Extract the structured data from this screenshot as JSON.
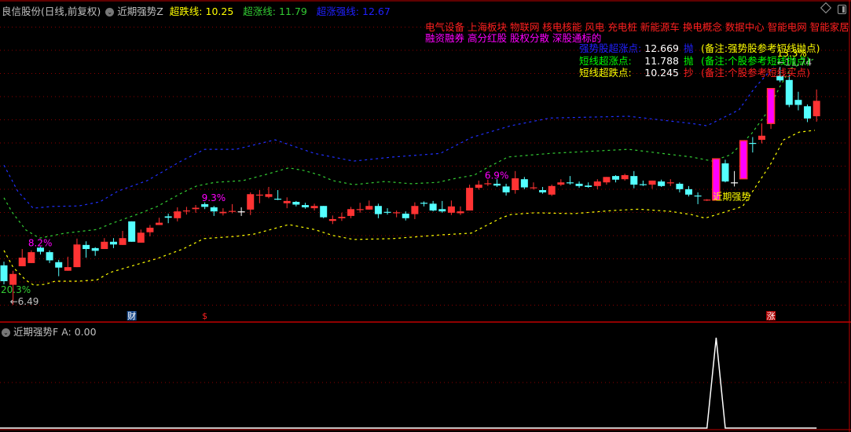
{
  "header": {
    "stock": "良信股份(日线,前复权)",
    "indicator": "近期强势Z",
    "lines": [
      {
        "label": "超跌线:",
        "value": "10.25",
        "color": "#ffff00"
      },
      {
        "label": "超涨线:",
        "value": "11.79",
        "color": "#33cc33"
      },
      {
        "label": "超涨强线:",
        "value": "12.67",
        "color": "#2020ff"
      }
    ]
  },
  "concepts": {
    "line1": "电气设备 上海板块 物联网 核电核能 风电 充电桩 新能源车 换电概念 数据中心 智能电网 智能家居 储能",
    "line2": "融资融券 高分红股 股权分散 深股通标的"
  },
  "info": [
    {
      "label": "强势股超涨点:",
      "value": "12.669",
      "action": "抛",
      "note": "(备注:强势股参考短线抛点)",
      "label_color": "#2020ff",
      "action_color": "#2020ff",
      "note_color": "#ffff00"
    },
    {
      "label": "短线超涨点:",
      "value": "11.788",
      "action": "抛",
      "note": "(备注:个股参考短线抛点)",
      "label_color": "#00ff00",
      "action_color": "#00ff00",
      "note_color": "#00ff00"
    },
    {
      "label": "短线超跌点:",
      "value": "10.245",
      "action": "抄",
      "note": "(备注:个股参考短线买点)",
      "label_color": "#ffff00",
      "action_color": "#ff2020",
      "note_color": "#ff2020"
    }
  ],
  "lower": {
    "title": "近期强势F",
    "value": "A: 0.00"
  },
  "colors": {
    "up": "#ff3333",
    "down": "#54ffff",
    "strong": "#ff00ff",
    "doji": "#ffffff",
    "grid": "#8b0000",
    "frame": "#c00000"
  },
  "chart_data": {
    "type": "candlestick",
    "title": "良信股份(日线,前复权)",
    "ylim": [
      6.49,
      11.74
    ],
    "candles_ohlc": [
      [
        7.36,
        7.44,
        6.94,
        7.01
      ],
      [
        6.93,
        7.24,
        6.49,
        7.17
      ],
      [
        7.34,
        7.72,
        7.34,
        7.53
      ],
      [
        7.41,
        7.69,
        7.41,
        7.65
      ],
      [
        7.75,
        7.77,
        7.6,
        7.66
      ],
      [
        7.65,
        7.69,
        7.41,
        7.47
      ],
      [
        7.43,
        7.48,
        7.12,
        7.31
      ],
      [
        7.24,
        7.55,
        7.24,
        7.32
      ],
      [
        7.32,
        7.95,
        7.32,
        7.82
      ],
      [
        7.81,
        7.89,
        7.53,
        7.72
      ],
      [
        7.74,
        7.76,
        7.57,
        7.68
      ],
      [
        7.72,
        7.96,
        7.72,
        7.88
      ],
      [
        7.88,
        7.96,
        7.74,
        7.82
      ],
      [
        7.81,
        8.12,
        7.81,
        7.96
      ],
      [
        8.33,
        8.33,
        7.88,
        7.88
      ],
      [
        7.86,
        8.15,
        7.86,
        8.08
      ],
      [
        8.09,
        8.25,
        8.0,
        8.19
      ],
      [
        8.25,
        8.41,
        8.25,
        8.3
      ],
      [
        8.44,
        8.5,
        8.29,
        8.41
      ],
      [
        8.4,
        8.64,
        8.33,
        8.55
      ],
      [
        8.55,
        8.65,
        8.48,
        8.57
      ],
      [
        8.6,
        8.69,
        8.52,
        8.63
      ],
      [
        8.71,
        8.75,
        8.6,
        8.65
      ],
      [
        8.64,
        8.67,
        8.45,
        8.55
      ],
      [
        8.51,
        8.62,
        8.46,
        8.54
      ],
      [
        8.55,
        8.71,
        8.51,
        8.56
      ],
      [
        8.55,
        8.64,
        8.45,
        8.55
      ],
      [
        8.59,
        8.97,
        8.47,
        8.93
      ],
      [
        8.91,
        9.02,
        8.73,
        8.92
      ],
      [
        8.87,
        9.09,
        8.84,
        8.93
      ],
      [
        8.83,
        9.02,
        8.8,
        8.82
      ],
      [
        8.73,
        8.86,
        8.62,
        8.78
      ],
      [
        8.76,
        8.78,
        8.66,
        8.7
      ],
      [
        8.69,
        8.74,
        8.61,
        8.64
      ],
      [
        8.62,
        8.72,
        8.57,
        8.67
      ],
      [
        8.67,
        8.67,
        8.4,
        8.42
      ],
      [
        8.34,
        8.46,
        8.27,
        8.38
      ],
      [
        8.4,
        8.52,
        8.34,
        8.43
      ],
      [
        8.45,
        8.65,
        8.4,
        8.6
      ],
      [
        8.59,
        8.74,
        8.52,
        8.6
      ],
      [
        8.59,
        8.79,
        8.59,
        8.67
      ],
      [
        8.67,
        8.72,
        8.4,
        8.49
      ],
      [
        8.54,
        8.62,
        8.48,
        8.53
      ],
      [
        8.52,
        8.57,
        8.42,
        8.53
      ],
      [
        8.5,
        8.55,
        8.35,
        8.4
      ],
      [
        8.49,
        8.75,
        8.38,
        8.67
      ],
      [
        8.74,
        8.77,
        8.66,
        8.73
      ],
      [
        8.72,
        8.78,
        8.55,
        8.57
      ],
      [
        8.6,
        8.78,
        8.52,
        8.55
      ],
      [
        8.52,
        8.79,
        8.47,
        8.66
      ],
      [
        8.51,
        8.66,
        8.47,
        8.55
      ],
      [
        8.57,
        9.14,
        8.57,
        9.07
      ],
      [
        9.07,
        9.23,
        9.03,
        9.14
      ],
      [
        9.16,
        9.25,
        9.11,
        9.17
      ],
      [
        9.16,
        9.26,
        9.09,
        9.12
      ],
      [
        9.1,
        9.16,
        8.9,
        8.97
      ],
      [
        9.02,
        9.44,
        8.94,
        9.28
      ],
      [
        9.26,
        9.31,
        9.04,
        9.08
      ],
      [
        9.07,
        9.19,
        9.03,
        9.08
      ],
      [
        9.02,
        9.09,
        8.94,
        8.97
      ],
      [
        8.92,
        9.14,
        8.89,
        9.11
      ],
      [
        9.14,
        9.26,
        9.11,
        9.19
      ],
      [
        9.19,
        9.33,
        9.14,
        9.18
      ],
      [
        9.16,
        9.21,
        9.07,
        9.11
      ],
      [
        9.12,
        9.19,
        9.07,
        9.09
      ],
      [
        9.11,
        9.26,
        9.04,
        9.21
      ],
      [
        9.19,
        9.31,
        9.14,
        9.31
      ],
      [
        9.33,
        9.35,
        9.19,
        9.25
      ],
      [
        9.26,
        9.38,
        9.23,
        9.35
      ],
      [
        9.33,
        9.44,
        9.06,
        9.14
      ],
      [
        9.15,
        9.23,
        9.11,
        9.14
      ],
      [
        9.14,
        9.23,
        9.05,
        9.23
      ],
      [
        9.21,
        9.25,
        9.09,
        9.11
      ],
      [
        9.18,
        9.26,
        9.11,
        9.19
      ],
      [
        9.16,
        9.19,
        8.97,
        9.04
      ],
      [
        9.04,
        9.11,
        8.88,
        8.92
      ],
      [
        8.9,
        8.97,
        8.71,
        8.89
      ],
      [
        8.8,
        8.82,
        8.78,
        8.81
      ],
      [
        8.8,
        9.71,
        8.8,
        9.71
      ],
      [
        9.61,
        9.69,
        9.19,
        9.21
      ],
      [
        9.19,
        9.44,
        9.1,
        9.19
      ],
      [
        9.27,
        10.11,
        9.27,
        10.11
      ],
      [
        10.06,
        10.19,
        9.85,
        10.05
      ],
      [
        10.13,
        10.49,
        10.05,
        10.22
      ],
      [
        10.49,
        11.26,
        10.37,
        11.26
      ],
      [
        11.54,
        11.74,
        11.4,
        11.44
      ],
      [
        11.45,
        11.57,
        10.85,
        10.9
      ],
      [
        11.01,
        11.19,
        10.78,
        10.9
      ],
      [
        10.87,
        10.91,
        10.52,
        10.6
      ],
      [
        10.65,
        11.24,
        10.53,
        10.99
      ]
    ],
    "strong_candles": [
      78,
      81,
      84
    ],
    "doji_white": [
      26,
      80
    ],
    "bands": [
      {
        "name": "超涨强线",
        "color": "#2030ff",
        "points": [
          [
            0,
            9.57
          ],
          [
            0.9,
            9.23
          ],
          [
            1.5,
            9.0
          ],
          [
            3.2,
            8.62
          ],
          [
            5.3,
            8.66
          ],
          [
            8.2,
            8.67
          ],
          [
            10.5,
            8.76
          ],
          [
            12.5,
            9.0
          ],
          [
            15.7,
            9.23
          ],
          [
            19.4,
            9.66
          ],
          [
            22,
            9.92
          ],
          [
            25.4,
            9.92
          ],
          [
            29.7,
            10.13
          ],
          [
            34,
            9.83
          ],
          [
            38.3,
            9.66
          ],
          [
            42.6,
            9.75
          ],
          [
            47.8,
            9.83
          ],
          [
            51.2,
            10.18
          ],
          [
            55.5,
            10.44
          ],
          [
            59.8,
            10.61
          ],
          [
            68.4,
            10.65
          ],
          [
            75.3,
            10.49
          ],
          [
            77,
            10.44
          ],
          [
            80.5,
            10.79
          ],
          [
            82.2,
            11.27
          ],
          [
            84.3,
            11.74
          ]
        ]
      },
      {
        "name": "超涨线",
        "color": "#33cc33",
        "points": [
          [
            0,
            8.85
          ],
          [
            0.9,
            8.53
          ],
          [
            2.4,
            8.14
          ],
          [
            3.9,
            7.96
          ],
          [
            6.7,
            8.07
          ],
          [
            10.2,
            8.15
          ],
          [
            11.6,
            8.27
          ],
          [
            14.8,
            8.5
          ],
          [
            16.8,
            8.66
          ],
          [
            19.6,
            8.97
          ],
          [
            21.1,
            9.11
          ],
          [
            23.1,
            9.19
          ],
          [
            26.2,
            9.23
          ],
          [
            28.8,
            9.37
          ],
          [
            31.2,
            9.51
          ],
          [
            32.9,
            9.45
          ],
          [
            34.6,
            9.35
          ],
          [
            36,
            9.23
          ],
          [
            38.3,
            9.14
          ],
          [
            41.7,
            9.21
          ],
          [
            44.6,
            9.16
          ],
          [
            47.5,
            9.19
          ],
          [
            49.5,
            9.28
          ],
          [
            51.5,
            9.35
          ],
          [
            52.9,
            9.51
          ],
          [
            55.2,
            9.75
          ],
          [
            59.8,
            9.83
          ],
          [
            68.4,
            9.92
          ],
          [
            75.3,
            9.75
          ],
          [
            77.6,
            9.66
          ],
          [
            79.6,
            9.8
          ],
          [
            81.9,
            10.27
          ],
          [
            83.6,
            10.74
          ],
          [
            85,
            11.31
          ],
          [
            86.2,
            11.71
          ],
          [
            88.8,
            11.92
          ]
        ]
      },
      {
        "name": "超跌线",
        "color": "#ffff00",
        "points": [
          [
            0,
            7.69
          ],
          [
            1,
            7.32
          ],
          [
            2.4,
            7.03
          ],
          [
            3.3,
            6.92
          ],
          [
            4.5,
            6.94
          ],
          [
            5.6,
            7.01
          ],
          [
            8.2,
            7.01
          ],
          [
            10.2,
            7.04
          ],
          [
            11.6,
            7.2
          ],
          [
            13.9,
            7.34
          ],
          [
            16.8,
            7.51
          ],
          [
            19.6,
            7.72
          ],
          [
            21.9,
            7.95
          ],
          [
            25.4,
            8.0
          ],
          [
            27.4,
            8.05
          ],
          [
            31.2,
            8.26
          ],
          [
            34,
            8.15
          ],
          [
            36,
            8.02
          ],
          [
            38.3,
            7.93
          ],
          [
            42.6,
            7.95
          ],
          [
            47.8,
            8.03
          ],
          [
            51.2,
            8.07
          ],
          [
            54.4,
            8.4
          ],
          [
            55.5,
            8.48
          ],
          [
            58.1,
            8.52
          ],
          [
            62.4,
            8.5
          ],
          [
            66.7,
            8.57
          ],
          [
            69.5,
            8.6
          ],
          [
            73,
            8.55
          ],
          [
            75.3,
            8.48
          ],
          [
            76.8,
            8.4
          ],
          [
            80.9,
            8.66
          ],
          [
            83.9,
            9.57
          ],
          [
            85.4,
            10.13
          ],
          [
            87.1,
            10.3
          ],
          [
            88.8,
            10.34
          ]
        ]
      }
    ],
    "annotations": [
      {
        "text": "20.3%",
        "index": 0,
        "price": 6.75,
        "color": "#33cc33"
      },
      {
        "text": "←6.49",
        "index": 1,
        "price": 6.49,
        "color": "#c0c0c0"
      },
      {
        "text": "8.2%",
        "index": 3,
        "price": 7.78,
        "color": "#ff00ff"
      },
      {
        "text": "9.3%",
        "index": 22,
        "price": 8.78,
        "color": "#ff00ff"
      },
      {
        "text": "6.9%",
        "index": 53,
        "price": 9.27,
        "color": "#ff00ff"
      },
      {
        "text": "近期强势",
        "index": 78,
        "price": 8.8,
        "color": "#ffff00"
      },
      {
        "text": "13.3%",
        "index": 85,
        "price": 11.97,
        "color": "#ffff00"
      },
      {
        "text": "←11.74",
        "index": 85,
        "price": 11.77,
        "color": "#c0c0c0"
      }
    ],
    "event_markers": [
      {
        "text": "财",
        "index": 14,
        "color": "#ffffff",
        "bg": "#1a4a8a"
      },
      {
        "text": "$",
        "index": 22,
        "color": "#ff2020",
        "bg": "transparent"
      },
      {
        "text": "涨",
        "index": 84,
        "color": "#ffffff",
        "bg": "#b00000"
      }
    ],
    "lower_series": {
      "name": "近期强势F",
      "values_nonzero": [
        [
          78,
          1
        ]
      ],
      "length": 90,
      "ylim": [
        0,
        1
      ]
    }
  }
}
